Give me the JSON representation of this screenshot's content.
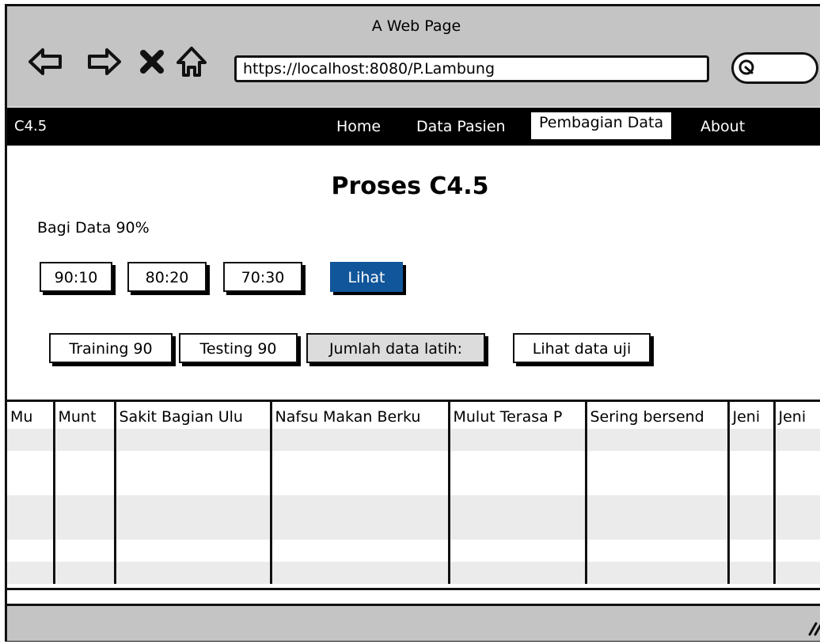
{
  "window": {
    "title": "A Web Page",
    "url": "https://localhost:8080/P.Lambung"
  },
  "navbar": {
    "brand": "C4.5",
    "items": [
      {
        "label": "Home"
      },
      {
        "label": "Data Pasien"
      },
      {
        "label": "Pembagian Data",
        "active": true
      },
      {
        "label": "About"
      }
    ]
  },
  "main": {
    "title": "Proses C4.5",
    "split_label": "Bagi Data 90%",
    "split_buttons": [
      "90:10",
      "80:20",
      "70:30"
    ],
    "view_button": "Lihat",
    "actions": [
      "Training 90",
      "Testing 90",
      "Jumlah data latih:",
      "Lihat data uji"
    ]
  },
  "table": {
    "columns": [
      "Mu",
      "Munt",
      "Sakit Bagian Ulu",
      "Nafsu Makan Berku",
      "Mulut Terasa P",
      "Sering bersend",
      "Jeni",
      "Jeni"
    ]
  },
  "colors": {
    "accent": "#11569a",
    "navbar": "#000000",
    "chrome": "#c4c4c4"
  }
}
